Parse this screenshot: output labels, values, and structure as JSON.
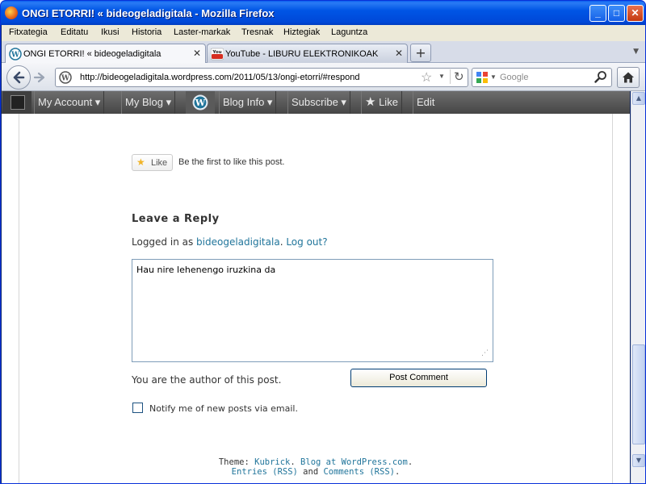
{
  "window": {
    "title": "ONGI ETORRI! « bideogeladigitala - Mozilla Firefox",
    "minimize_label": "_",
    "maximize_label": "□",
    "close_label": "✕"
  },
  "menu": {
    "items": [
      "Fitxategia",
      "Editatu",
      "Ikusi",
      "Historia",
      "Laster-markak",
      "Tresnak",
      "Hiztegiak",
      "Laguntza"
    ]
  },
  "tabs": {
    "items": [
      {
        "label": "ONGI ETORRI! « bideogeladigitala",
        "icon": "wordpress-icon",
        "close": "✕"
      },
      {
        "label": "YouTube - LIBURU ELEKTRONIKOAK",
        "icon": "youtube-icon",
        "close": "✕"
      }
    ],
    "new_tab_label": "+",
    "list_arrow": "▼"
  },
  "navigation": {
    "url": "http://bideogeladigitala.wordpress.com/2011/05/13/ongi-etorri/#respond",
    "search_placeholder": "Google"
  },
  "adminbar": {
    "my_account": "My Account ▾",
    "my_blog": "My Blog ▾",
    "blog_info": "Blog Info ▾",
    "subscribe": "Subscribe ▾",
    "like": "Like",
    "edit": "Edit"
  },
  "post": {
    "like_button": "Like",
    "like_text": "Be the first to like this post.",
    "reply_title": "Leave a Reply",
    "logged_in_prefix": "Logged in as ",
    "username": "bideogeladigitala",
    "logout": "Log out?",
    "comment_value": "Hau nire lehenengo iruzkina da",
    "author_note": "You are the author of this post.",
    "post_comment_button": "Post Comment",
    "notify_label": "Notify me of new posts via email."
  },
  "footer": {
    "theme_prefix": "Theme: ",
    "theme_link": "Kubrick",
    "blog_link": "Blog at WordPress.com",
    "entries_link": "Entries (RSS)",
    "and_text": " and ",
    "comments_link": "Comments (RSS)"
  },
  "colors": {
    "titlebar": "#0055e5",
    "adminbar": "#464646",
    "link": "#21759b"
  }
}
